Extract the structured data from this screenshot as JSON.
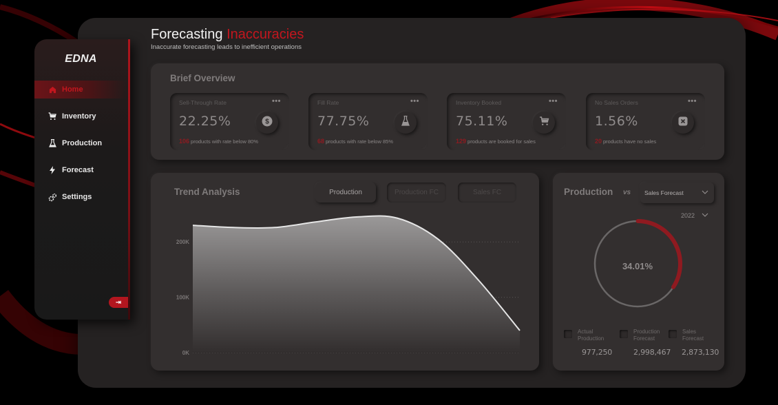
{
  "app": {
    "brand": "EDNA"
  },
  "sidebar": {
    "items": [
      {
        "label": "Home",
        "icon": "home-icon",
        "active": true
      },
      {
        "label": "Inventory",
        "icon": "cart-icon",
        "active": false
      },
      {
        "label": "Production",
        "icon": "flask-icon",
        "active": false
      },
      {
        "label": "Forecast",
        "icon": "bolt-icon",
        "active": false
      },
      {
        "label": "Settings",
        "icon": "gear-icon",
        "active": false
      }
    ],
    "logout_icon": "logout-icon",
    "logout_glyph": "⇥"
  },
  "header": {
    "title_main": "Forecasting",
    "title_accent": "Inaccuracies",
    "subtitle": "Inaccurate forecasting leads to inefficient operations"
  },
  "colors": {
    "accent": "#c3161e",
    "accent_dark": "#8f1a20",
    "panel": "#332f2f",
    "shell": "#252222"
  },
  "overview": {
    "title": "Brief Overview",
    "kpis": [
      {
        "label": "Sell-Through Rate",
        "value": "22.25%",
        "count": "106",
        "foot": "products with rate below 80%",
        "icon": "dollar-icon",
        "menu": "•••"
      },
      {
        "label": "Fill Rate",
        "value": "77.75%",
        "count": "68",
        "foot": "products with rate below 85%",
        "icon": "flask-icon",
        "menu": "•••"
      },
      {
        "label": "Inventory Booked",
        "value": "75.11%",
        "count": "129",
        "foot": "products are booked for sales",
        "icon": "cart-icon",
        "menu": "•••"
      },
      {
        "label": "No Sales Orders",
        "value": "1.56%",
        "count": "20",
        "foot": "products have no sales",
        "icon": "close-box-icon",
        "menu": "•••"
      }
    ]
  },
  "trend": {
    "title": "Trend Analysis",
    "toggles": [
      {
        "label": "Production",
        "active": true
      },
      {
        "label": "Production FC",
        "active": false
      },
      {
        "label": "Sales FC",
        "active": false
      }
    ]
  },
  "chart_data": {
    "type": "area",
    "title": "Trend Analysis",
    "series": [
      {
        "name": "Production",
        "values": [
          230000,
          226000,
          226000,
          236000,
          245000,
          243000,
          205000,
          130000,
          40000
        ]
      }
    ],
    "x": [
      1,
      2,
      3,
      4,
      5,
      6,
      7,
      8,
      9
    ],
    "xlabel": "",
    "ylabel": "",
    "yticks": [
      "0K",
      "100K",
      "200K"
    ],
    "ytick_values": [
      0,
      100000,
      200000
    ],
    "ylim": [
      0,
      250000
    ],
    "grid": true,
    "legend": "none"
  },
  "production_vs": {
    "title": "Production",
    "vs_label": "vs",
    "compare_select": "Sales Forecast",
    "year_select": "2022",
    "donut": {
      "percent": 34.01,
      "label": "34.01%"
    },
    "legend": [
      {
        "line1": "Actual",
        "line2": "Production",
        "value": "977,250"
      },
      {
        "line1": "Production",
        "line2": "Forecast",
        "value": "2,998,467"
      },
      {
        "line1": "Sales",
        "line2": "Forecast",
        "value": "2,873,130"
      }
    ]
  }
}
